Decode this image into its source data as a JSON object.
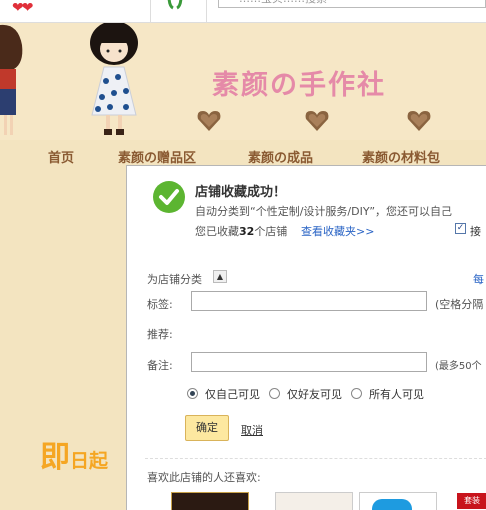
{
  "topbar": {
    "search_text": "……宝贝……搜索"
  },
  "shop": {
    "name": "素颜の手作社",
    "nav": [
      "首页",
      "素颜の赠品区",
      "素颜の成品",
      "素颜の材料包"
    ],
    "promo_big": "即",
    "promo_rest": "日起"
  },
  "dialog": {
    "title": "店铺收藏成功！",
    "auto_category": "自动分类到“个性定制/设计服务/DIY”，您还可以自己",
    "count_prefix": "您已收藏",
    "count_value": "32",
    "count_suffix": "个店铺",
    "view_link": "查看收藏夹>>",
    "receive_label": "接",
    "receive_checked": true,
    "category_label": "为店铺分类",
    "category_more": "每",
    "tag_label": "标签:",
    "tag_value": "",
    "tag_hint": "(空格分隔",
    "recommend_label": "推荐:",
    "note_label": "备注:",
    "note_value": "",
    "note_hint": "(最多50个",
    "visibility": [
      {
        "label": "仅自己可见",
        "selected": true
      },
      {
        "label": "仅好友可见",
        "selected": false
      },
      {
        "label": "所有人可见",
        "selected": false
      }
    ],
    "confirm": "确定",
    "cancel": "取消",
    "also_like": "喜欢此店铺的人还喜欢:",
    "badge": "套装"
  },
  "colors": {
    "background": "#f3e4c0",
    "title_pink": "#e58aa8",
    "nav_brown": "#8a5a32",
    "success_green": "#5cb531",
    "link_blue": "#2a64c5",
    "button_yellow": "#fde8a0",
    "promo_orange": "#f5a623"
  }
}
